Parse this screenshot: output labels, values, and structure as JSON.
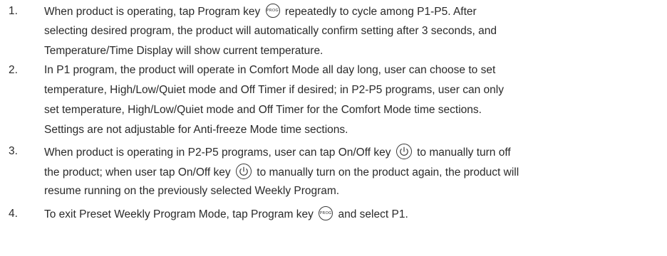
{
  "keys": {
    "program_key_label": "PROG"
  },
  "steps": [
    {
      "number": "1.",
      "lines": [
        {
          "before": "When product is operating, tap Program key",
          "icon": "prog",
          "after": "repeatedly to cycle among P1-P5. After"
        },
        {
          "text": "selecting desired program, the product will automatically confirm setting after 3 seconds, and"
        },
        {
          "text": "Temperature/Time Display will show current temperature."
        }
      ]
    },
    {
      "number": "2.",
      "lines": [
        {
          "text": "In P1 program, the product will operate in Comfort Mode all day long, user can choose to set"
        },
        {
          "text": "temperature, High/Low/Quiet mode and Off Timer if desired; in P2-P5 programs, user can only"
        },
        {
          "text": "set temperature, High/Low/Quiet mode and Off Timer for the Comfort Mode time sections."
        },
        {
          "text": "Settings are not adjustable for Anti-freeze Mode time sections."
        }
      ]
    },
    {
      "number": "3.",
      "lines": [
        {
          "before": "When product is operating in P2-P5 programs, user can tap On/Off key",
          "icon": "power",
          "after": "to manually turn off"
        },
        {
          "before": "the product; when user tap On/Off key",
          "icon": "power",
          "after": "to manually turn on the product again, the product will"
        },
        {
          "text": "resume running on the previously selected Weekly Program."
        }
      ]
    },
    {
      "number": "4.",
      "lines": [
        {
          "before": "To exit Preset Weekly Program Mode, tap Program key",
          "icon": "prog",
          "after": "and select P1."
        }
      ]
    }
  ]
}
